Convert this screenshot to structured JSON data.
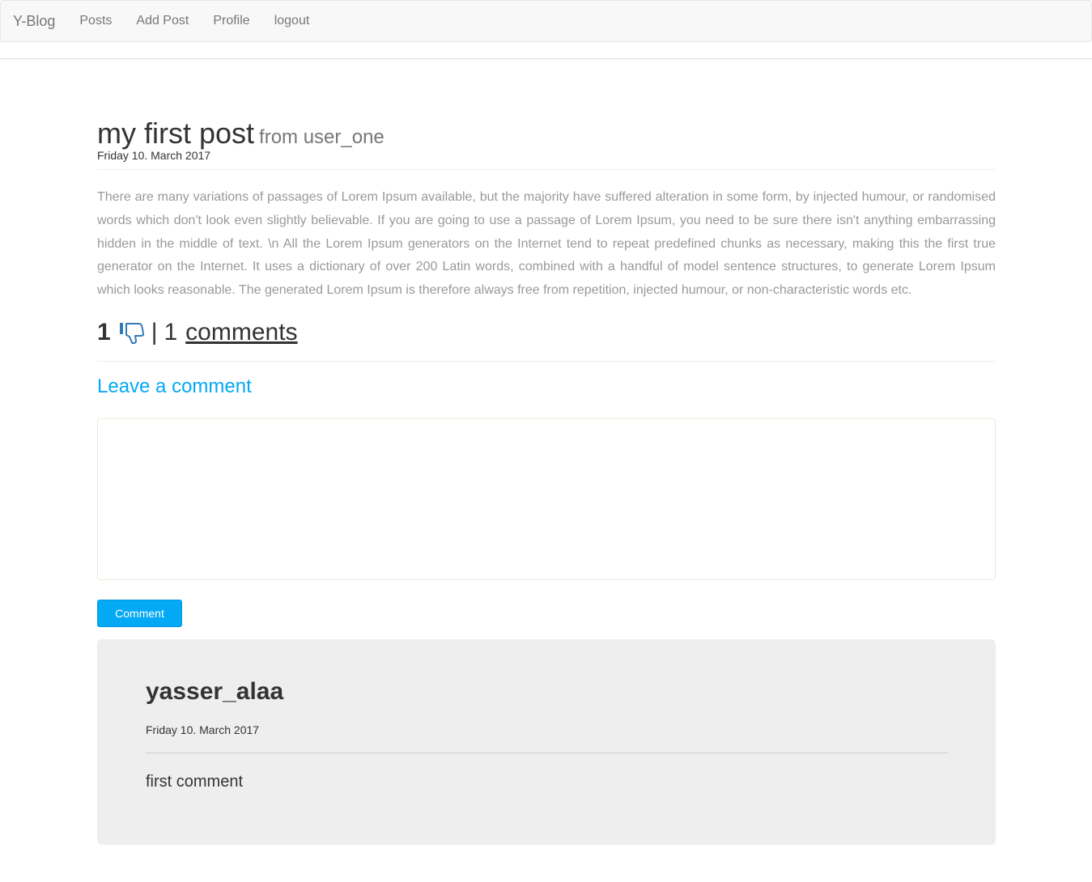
{
  "navbar": {
    "brand": "Y-Blog",
    "links": [
      "Posts",
      "Add Post",
      "Profile",
      "logout"
    ]
  },
  "post": {
    "title": "my first post",
    "author": "from user_one",
    "date": "Friday 10. March 2017",
    "body": "There are many variations of passages of Lorem Ipsum available, but the majority have suffered alteration in some form, by injected humour, or randomised words which don't look even slightly believable. If you are going to use a passage of Lorem Ipsum, you need to be sure there isn't anything embarrassing hidden in the middle of text. \\n All the Lorem Ipsum generators on the Internet tend to repeat predefined chunks as necessary, making this the first true generator on the Internet. It uses a dictionary of over 200 Latin words, combined with a handful of model sentence structures, to generate Lorem Ipsum which looks reasonable. The generated Lorem Ipsum is therefore always free from repetition, injected humour, or non-characteristic words etc.",
    "likes": "1",
    "separator": "|",
    "comments_count": "1",
    "comments_label": "comments",
    "dislike_icon": "thumbs-down-icon",
    "icon_color": "#337ab7"
  },
  "comment_form": {
    "heading": "Leave a comment",
    "textarea_value": "",
    "button_label": "Comment",
    "accent_color": "#03a9f4"
  },
  "comments": [
    {
      "user": "yasser_alaa",
      "date": "Friday 10. March 2017",
      "text": "first comment"
    }
  ]
}
